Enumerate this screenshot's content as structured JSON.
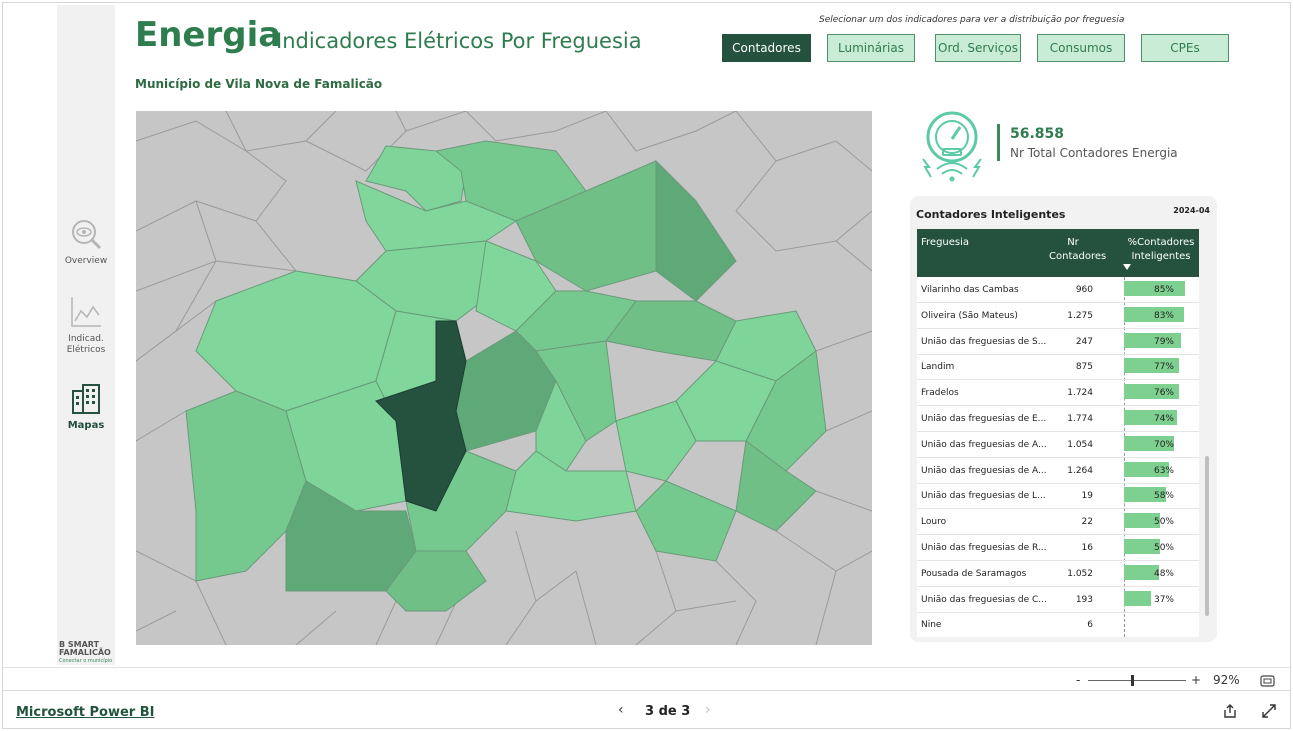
{
  "app": {
    "footer_link": "Microsoft Power BI",
    "page_indicator": "3 de 3",
    "zoom_level": "92%",
    "zoom_minus": "-",
    "zoom_plus": "+"
  },
  "sidebar": {
    "items": [
      {
        "label": "Overview",
        "icon": "eye-magnifier-icon"
      },
      {
        "label": "Indicad. Elétricos",
        "icon": "line-chart-icon"
      },
      {
        "label": "Mapas",
        "icon": "buildings-icon"
      }
    ],
    "logo_text": "B SMART FAMALICÃO",
    "logo_sub": "Conectar o município"
  },
  "header": {
    "title": "Energia",
    "subtitle": "Indicadores Elétricos Por Freguesia",
    "municipio": "Município de Vila Nova de Famalicão",
    "hint": "Selecionar um dos indicadores para ver a distribuição por freguesia",
    "indicators": [
      {
        "label": "Contadores",
        "active": true
      },
      {
        "label": "Luminárias",
        "active": false
      },
      {
        "label": "Ord. Serviços",
        "active": false
      },
      {
        "label": "Consumos",
        "active": false
      },
      {
        "label": "CPEs",
        "active": false
      }
    ]
  },
  "kpi": {
    "value": "56.858",
    "label": "Nr Total Contadores Energia",
    "icon": "smart-meter-icon"
  },
  "table": {
    "title": "Contadores Inteligentes",
    "date": "2024-04",
    "headers": [
      "Freguesia",
      "Nr Contadores",
      "%Contadores Inteligentes"
    ],
    "rows": [
      {
        "name": "Vilarinho das Cambas",
        "nr": "960",
        "pct": "85%",
        "pct_value": 85
      },
      {
        "name": "Oliveira (São Mateus)",
        "nr": "1.275",
        "pct": "83%",
        "pct_value": 83
      },
      {
        "name": "União das freguesias de S...",
        "nr": "247",
        "pct": "79%",
        "pct_value": 79
      },
      {
        "name": "Landim",
        "nr": "875",
        "pct": "77%",
        "pct_value": 77
      },
      {
        "name": "Fradelos",
        "nr": "1.724",
        "pct": "76%",
        "pct_value": 76
      },
      {
        "name": "União das freguesias de E...",
        "nr": "1.774",
        "pct": "74%",
        "pct_value": 74
      },
      {
        "name": "União das freguesias de A...",
        "nr": "1.054",
        "pct": "70%",
        "pct_value": 70
      },
      {
        "name": "União das freguesias de A...",
        "nr": "1.264",
        "pct": "63%",
        "pct_value": 63
      },
      {
        "name": "União das freguesias de L...",
        "nr": "19",
        "pct": "58%",
        "pct_value": 58
      },
      {
        "name": "Louro",
        "nr": "22",
        "pct": "50%",
        "pct_value": 50
      },
      {
        "name": "União das freguesias de R...",
        "nr": "16",
        "pct": "50%",
        "pct_value": 50
      },
      {
        "name": "Pousada de Saramagos",
        "nr": "1.052",
        "pct": "48%",
        "pct_value": 48
      },
      {
        "name": "União das freguesias de C...",
        "nr": "193",
        "pct": "37%",
        "pct_value": 37
      },
      {
        "name": "Nine",
        "nr": "6",
        "pct": "",
        "pct_value": 0
      }
    ]
  },
  "colors": {
    "dark_green": "#24523f",
    "accent_green": "#2e7d4f",
    "light_green": "#c9ecd6",
    "bar_green": "#7dd08f",
    "map_gray": "#c6c6c6"
  }
}
